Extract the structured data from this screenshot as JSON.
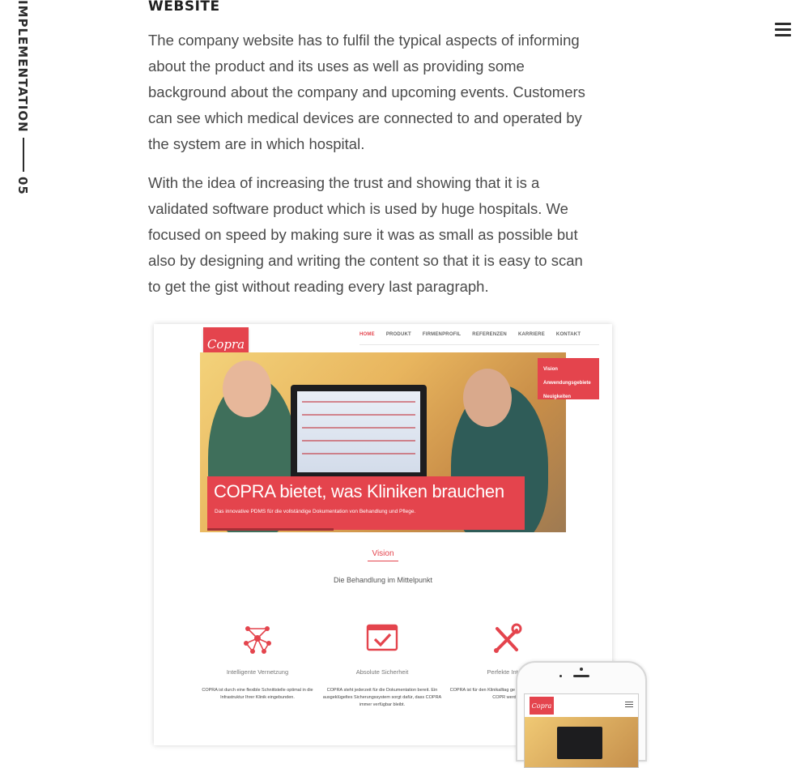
{
  "side": {
    "label": "IMPLEMENTATION",
    "number": "05"
  },
  "section": {
    "title": "WEBSITE",
    "paragraphs": [
      "The company website has to fulfil the typical aspects of informing about the product and its uses as well as providing some background about the company and upcoming events. Customers can see which medical devices are connected to and operated by the system are in which hospital.",
      "With the idea of increasing the trust and showing that it is a validated software product which is used by huge hospitals. We focused on speed by making sure it was as small as possible but also by designing and writing the content so that it is easy to scan to get the gist without reading every last paragraph."
    ]
  },
  "mockup": {
    "logo": "Copra",
    "nav": [
      "HOME",
      "PRODUKT",
      "FIRMENPROFIL",
      "REFERENZEN",
      "KARRIERE",
      "KONTAKT"
    ],
    "side_menu": [
      "Vision",
      "Anwendungsgebiete",
      "Neuigkeiten"
    ],
    "hero_title": "COPRA bietet, was Kliniken brauchen",
    "hero_subtitle": "Das innovative PDMS für die vollständige Dokumentation von Behandlung und Pflege.",
    "vision_title": "Vision",
    "vision_subtitle": "Die Behandlung im Mittelpunkt",
    "features": [
      {
        "title": "Intelligente Vernetzung",
        "desc": "COPRA ist durch eine flexible Schnittstelle optimal in die Infrastruktur Ihrer Klinik eingebunden."
      },
      {
        "title": "Absolute Sicherheit",
        "desc": "COPRA steht jederzeit für die Dokumentation bereit. Ein ausgeklügeltes Sicherungssystem sorgt dafür, dass COPRA immer verfügbar bleibt."
      },
      {
        "title": "Perfekte Integr",
        "desc": "COPRA ist für den Klinikalltag ge Anpassungen können in COPR werden"
      }
    ],
    "phone_logo": "Copra"
  },
  "colors": {
    "accent": "#e4444d",
    "text": "#4a4a4a",
    "heading": "#1f1f1f"
  },
  "icons": [
    "hamburger-menu-icon",
    "network-icon",
    "checkmark-security-icon",
    "tools-icon"
  ]
}
